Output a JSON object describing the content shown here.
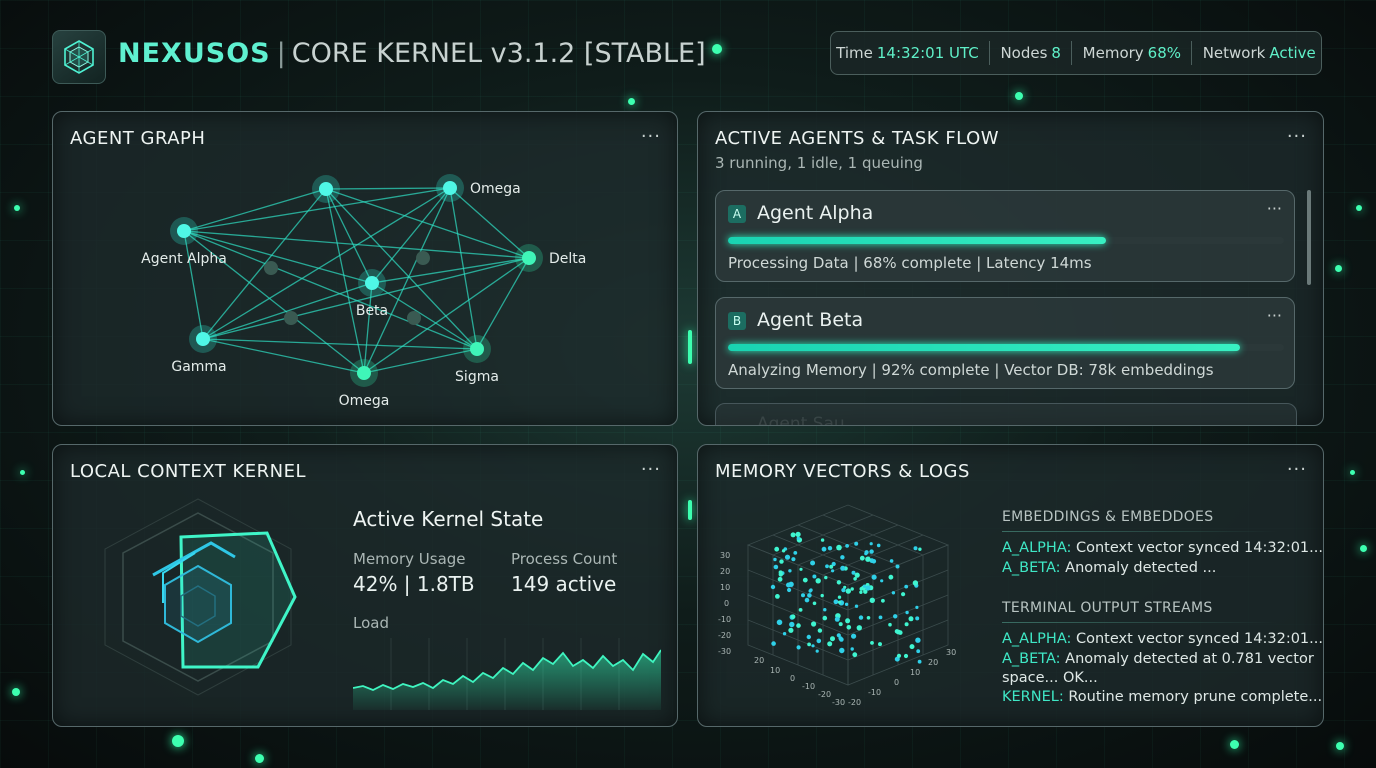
{
  "header": {
    "brand": "NEXUSOS",
    "separator": "|",
    "subtitle": "CORE KERNEL v3.1.2 [STABLE]",
    "status": [
      {
        "label": "Time",
        "value": "14:32:01 UTC"
      },
      {
        "label": "Nodes",
        "value": "8"
      },
      {
        "label": "Memory",
        "value": "68%"
      },
      {
        "label": "Network",
        "value": "Active"
      }
    ]
  },
  "agent_graph": {
    "title": "AGENT GRAPH",
    "more": "···",
    "nodes": [
      "Agent Alpha",
      "Omega",
      "Delta",
      "Beta",
      "Gamma",
      "Sigma",
      "Omega"
    ]
  },
  "agents_panel": {
    "title": "ACTIVE AGENTS & TASK FLOW",
    "subtitle": "3 running, 1 idle, 1 queuing",
    "more": "···",
    "agents": [
      {
        "badge": "A",
        "name": "Agent Alpha",
        "progress": 0.68,
        "info": "Processing Data | 68% complete | Latency 14ms"
      },
      {
        "badge": "B",
        "name": "Agent Beta",
        "progress": 0.92,
        "info": "Analyzing Memory | 92% complete | Vector DB: 78k embeddings"
      }
    ],
    "ghost_label": "Agent Sau..."
  },
  "kernel_panel": {
    "title": "LOCAL CONTEXT KERNEL",
    "more": "···",
    "state_title": "Active Kernel State",
    "memory_label": "Memory Usage",
    "memory_value": "42% | 1.8TB",
    "process_label": "Process Count",
    "process_value": "149 active",
    "load_label": "Load"
  },
  "memory_panel": {
    "title": "MEMORY VECTORS & LOGS",
    "more": "···",
    "embeddings_title": "EMBEDDINGS & EMBEDDOES",
    "embeddings": [
      {
        "tag": "A_ALPHA:",
        "text": " Context vector synced 14:32:01..."
      },
      {
        "tag": "A_BETA:",
        "text": " Anomaly detected ..."
      }
    ],
    "terminal_title": "TERMINAL OUTPUT STREAMS",
    "terminal": [
      {
        "tag": "A_ALPHA:",
        "text": " Context vector synced 14:32:01..."
      },
      {
        "tag": "A_BETA:",
        "text": " Anomaly detected at 0.781 vector"
      },
      {
        "tag": "",
        "text": "space... OK..."
      },
      {
        "tag": "KERNEL:",
        "text": " Routine memory prune complete..."
      }
    ],
    "axis_ticks_left": [
      "30",
      "20",
      "10",
      "0",
      "-10",
      "-20",
      "-30"
    ],
    "axis_ticks_bottom_left": [
      "30",
      "20",
      "10",
      "0",
      "-10",
      "-20",
      "-30"
    ],
    "axis_ticks_bottom_right": [
      "-20",
      "-10",
      "0",
      "10",
      "20",
      "30"
    ]
  },
  "colors": {
    "accent": "#3fe8c6",
    "brand": "#5ff0d0",
    "panel_border": "#56686a"
  }
}
